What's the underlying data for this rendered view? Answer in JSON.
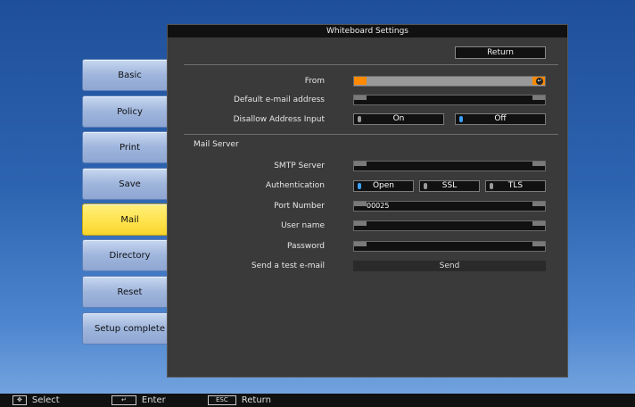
{
  "sidebar": {
    "items": [
      {
        "label": "Basic"
      },
      {
        "label": "Policy"
      },
      {
        "label": "Print"
      },
      {
        "label": "Save"
      },
      {
        "label": "Mail",
        "active": true
      },
      {
        "label": "Directory"
      },
      {
        "label": "Reset"
      },
      {
        "label": "Setup complete"
      }
    ]
  },
  "panel": {
    "title": "Whiteboard Settings",
    "return_label": "Return",
    "from_label": "From",
    "default_email_label": "Default e-mail address",
    "disallow_label": "Disallow Address Input",
    "disallow_options": [
      "On",
      "Off"
    ],
    "disallow_selected": "Off",
    "mail_server_heading": "Mail Server",
    "smtp_label": "SMTP Server",
    "auth_label": "Authentication",
    "auth_options": [
      "Open",
      "SSL",
      "TLS"
    ],
    "auth_selected": "Open",
    "port_label": "Port Number",
    "port_value": "00025",
    "username_label": "User name",
    "password_label": "Password",
    "test_label": "Send a test e-mail",
    "send_label": "Send"
  },
  "footer": {
    "select_label": "Select",
    "enter_label": "Enter",
    "esc_key": "ESC",
    "return_label": "Return"
  },
  "colors": {
    "active_tab": "#ffe24a",
    "accent_orange": "#ff8a00",
    "radio_on": "#3aa0ff"
  }
}
